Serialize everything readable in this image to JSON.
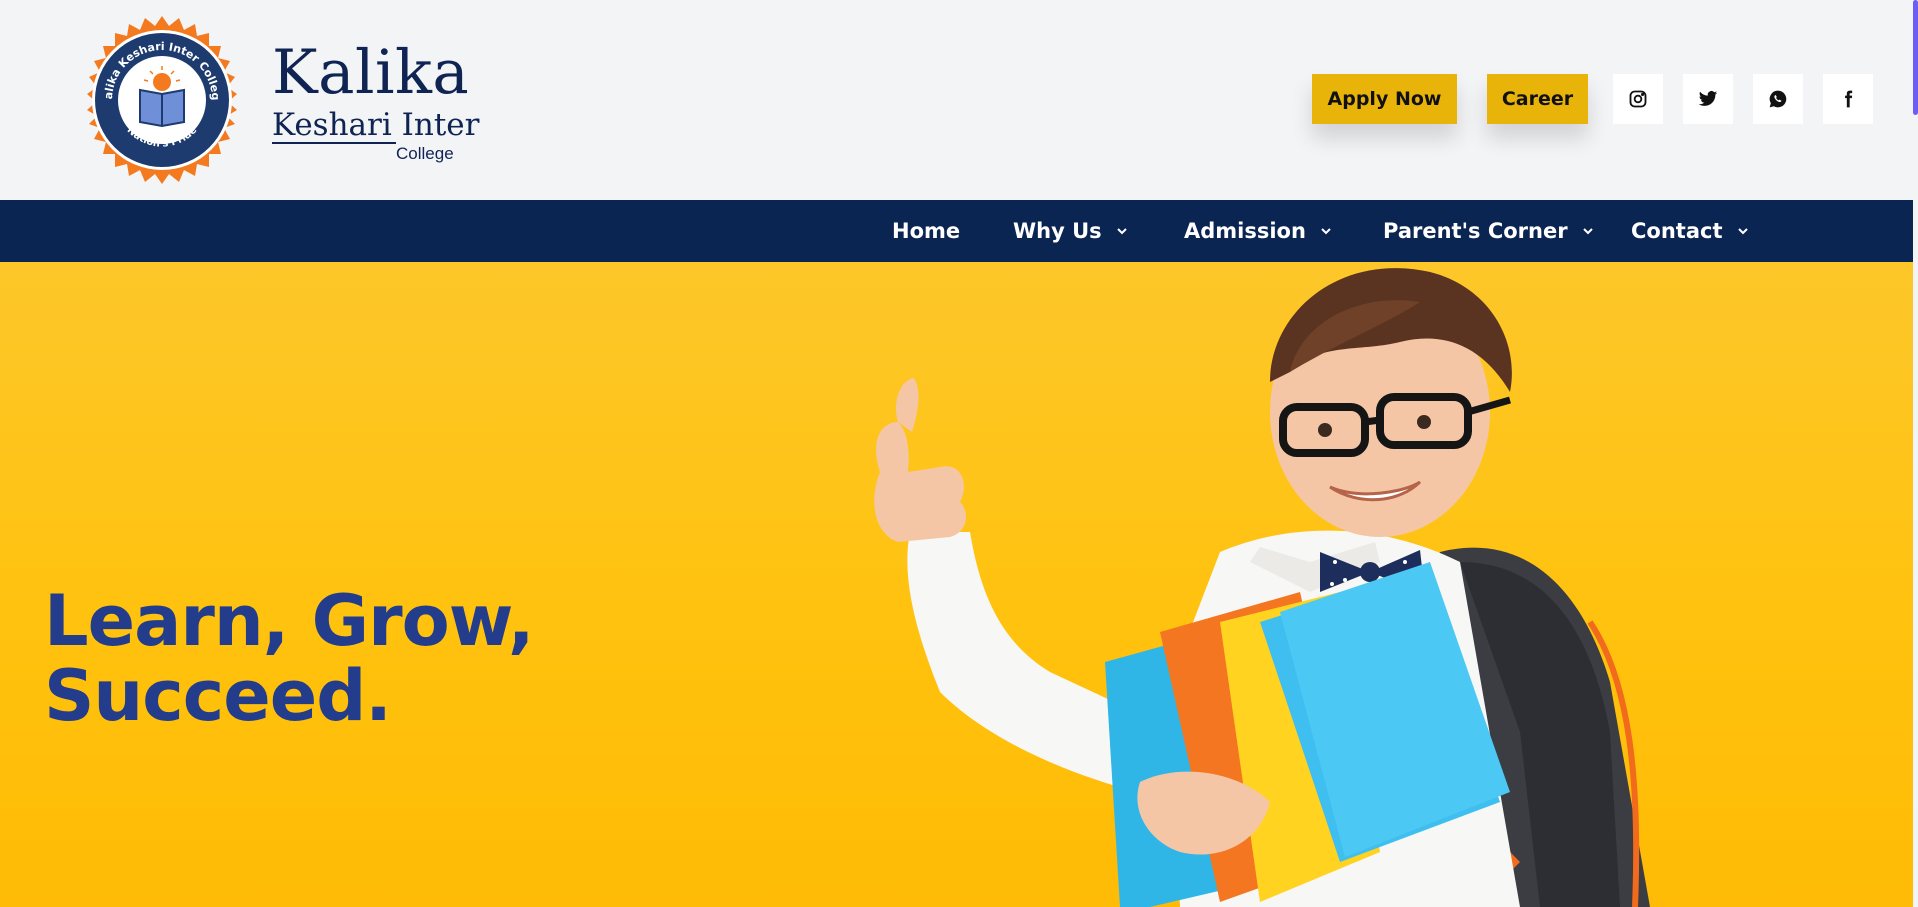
{
  "brand": {
    "line1": "Kalika",
    "line2": "Keshari Inter",
    "line3": "College",
    "seal_top_text": "Kalika Keshari Inter College",
    "seal_bottom_text": "Nation's Pride"
  },
  "header": {
    "apply_label": "Apply Now",
    "career_label": "Career",
    "social": [
      "instagram-icon",
      "twitter-icon",
      "whatsapp-icon",
      "facebook-icon"
    ]
  },
  "nav": {
    "items": [
      {
        "label": "Home",
        "has_dropdown": false
      },
      {
        "label": "Why Us",
        "has_dropdown": true
      },
      {
        "label": "Admission",
        "has_dropdown": true
      },
      {
        "label": "Parent's Corner",
        "has_dropdown": true
      },
      {
        "label": "Contact",
        "has_dropdown": true
      }
    ]
  },
  "hero": {
    "line1": "Learn, Grow,",
    "line2": "Succeed."
  },
  "colors": {
    "navy": "#0b2553",
    "accent_yellow": "#e9b409",
    "hero_bg": "#ffc20e",
    "hero_text": "#233d8c",
    "seal_orange": "#f47a20"
  }
}
